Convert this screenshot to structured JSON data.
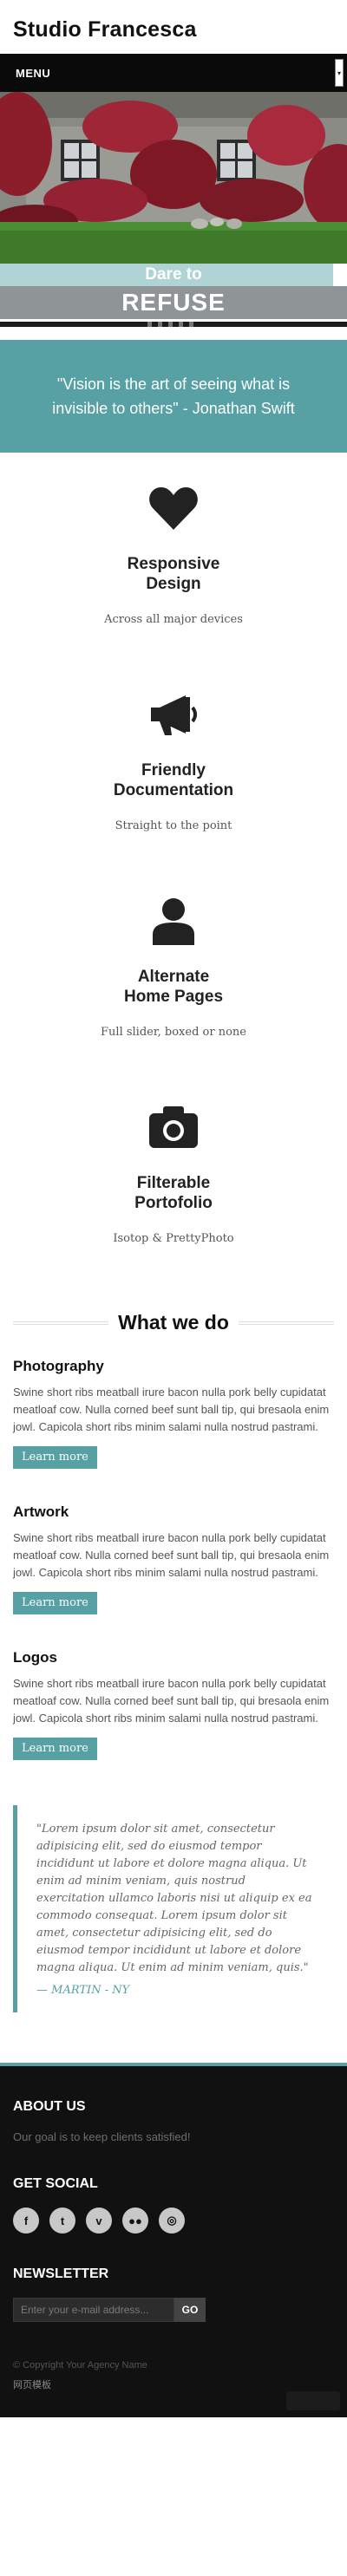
{
  "header": {
    "brand": "Studio Francesca"
  },
  "menu": {
    "label": "MENU",
    "toggle_icon": "chevron-down-icon"
  },
  "hero": {
    "tagline_small": "Dare to",
    "tagline_big": "REFUSE"
  },
  "quote": {
    "text": "\"Vision is the art of seeing what is invisible to others\" - Jonathan Swift"
  },
  "features": [
    {
      "icon": "heart-icon",
      "title_line1": "Responsive",
      "title_line2": "Design",
      "subtitle": "Across all major devices"
    },
    {
      "icon": "megaphone-icon",
      "title_line1": "Friendly",
      "title_line2": "Documentation",
      "subtitle": "Straight to the point"
    },
    {
      "icon": "user-icon",
      "title_line1": "Alternate",
      "title_line2": "Home Pages",
      "subtitle": "Full slider, boxed or none"
    },
    {
      "icon": "camera-icon",
      "title_line1": "Filterable",
      "title_line2": "Portofolio",
      "subtitle": "Isotop & PrettyPhoto"
    }
  ],
  "whatwedo": {
    "title": "What we do"
  },
  "services": [
    {
      "title": "Photography",
      "text": "Swine short ribs meatball irure bacon nulla pork belly cupidatat meatloaf cow. Nulla corned beef sunt ball tip, qui bresaola enim jowl. Capicola short ribs minim salami nulla nostrud pastrami.",
      "button": "Learn more"
    },
    {
      "title": "Artwork",
      "text": "Swine short ribs meatball irure bacon nulla pork belly cupidatat meatloaf cow. Nulla corned beef sunt ball tip, qui bresaola enim jowl. Capicola short ribs minim salami nulla nostrud pastrami.",
      "button": "Learn more"
    },
    {
      "title": "Logos",
      "text": "Swine short ribs meatball irure bacon nulla pork belly cupidatat meatloaf cow. Nulla corned beef sunt ball tip, qui bresaola enim jowl. Capicola short ribs minim salami nulla nostrud pastrami.",
      "button": "Learn more"
    }
  ],
  "testimonial": {
    "text": "\"Lorem ipsum dolor sit amet, consectetur adipisicing elit, sed do eiusmod tempor incididunt ut labore et dolore magna aliqua. Ut enim ad minim veniam, quis nostrud exercitation ullamco laboris nisi ut aliquip ex ea commodo consequat. Lorem ipsum dolor sit amet, consectetur adipisicing elit, sed do eiusmod tempor incididunt ut labore et dolore magna aliqua. Ut enim ad minim veniam, quis.\"",
    "author": "— MARTIN - NY"
  },
  "footer": {
    "about_title": "ABOUT US",
    "about_text": "Our goal is to keep clients satisfied!",
    "social_title": "GET SOCIAL",
    "newsletter_title": "NEWSLETTER",
    "newsletter_placeholder": "Enter your e-mail address...",
    "newsletter_button": "GO",
    "copyright": "© Copyright Your Agency Name",
    "note": "网页模板"
  },
  "colors": {
    "accent": "#57a0a3",
    "dark": "#111111"
  }
}
